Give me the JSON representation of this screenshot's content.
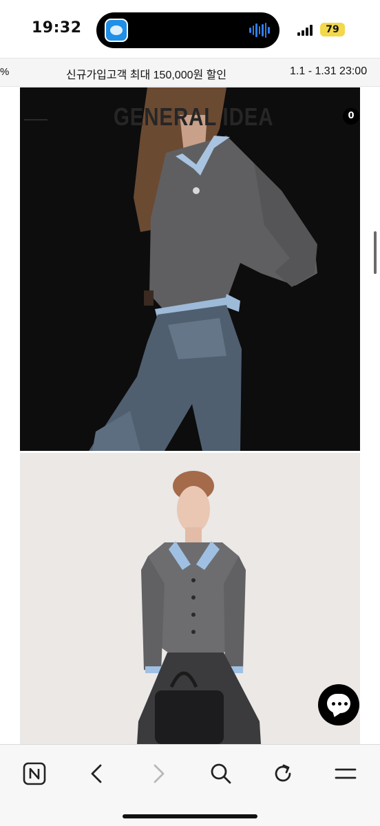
{
  "status_bar": {
    "time": "19:32",
    "battery_percent": "79",
    "icons": [
      "app-activity-icon",
      "audio-wave-icon",
      "cellular-signal-icon",
      "battery-charging-icon"
    ],
    "battery_color": "#f2d84a"
  },
  "promo_banner": {
    "left_fragment": "%",
    "text": "신규가입고객 최대 150,000원 할인",
    "date_range": "1.1 - 1.31 23:00"
  },
  "site_header": {
    "logo_text": "GENERAL IDEA",
    "cart_count": "0",
    "icons": [
      "hamburger-menu-icon",
      "cart-icon"
    ]
  },
  "product_photos": [
    {
      "alt": "dark studio model photo, grey cardigan with blue collar and denim"
    },
    {
      "alt": "light studio model photo, grey cardigan with blue collar and dark pleated skirt"
    }
  ],
  "chat_button": {
    "icon": "chat-bubble-icon"
  },
  "browser_toolbar": {
    "buttons": [
      {
        "name": "naver-home-button",
        "icon": "naver-n-icon",
        "enabled": true
      },
      {
        "name": "back-button",
        "icon": "chevron-left-icon",
        "enabled": true
      },
      {
        "name": "forward-button",
        "icon": "chevron-right-icon",
        "enabled": false
      },
      {
        "name": "search-button",
        "icon": "search-icon",
        "enabled": true
      },
      {
        "name": "reload-button",
        "icon": "reload-icon",
        "enabled": true
      },
      {
        "name": "menu-button",
        "icon": "menu-icon",
        "enabled": true
      }
    ]
  }
}
